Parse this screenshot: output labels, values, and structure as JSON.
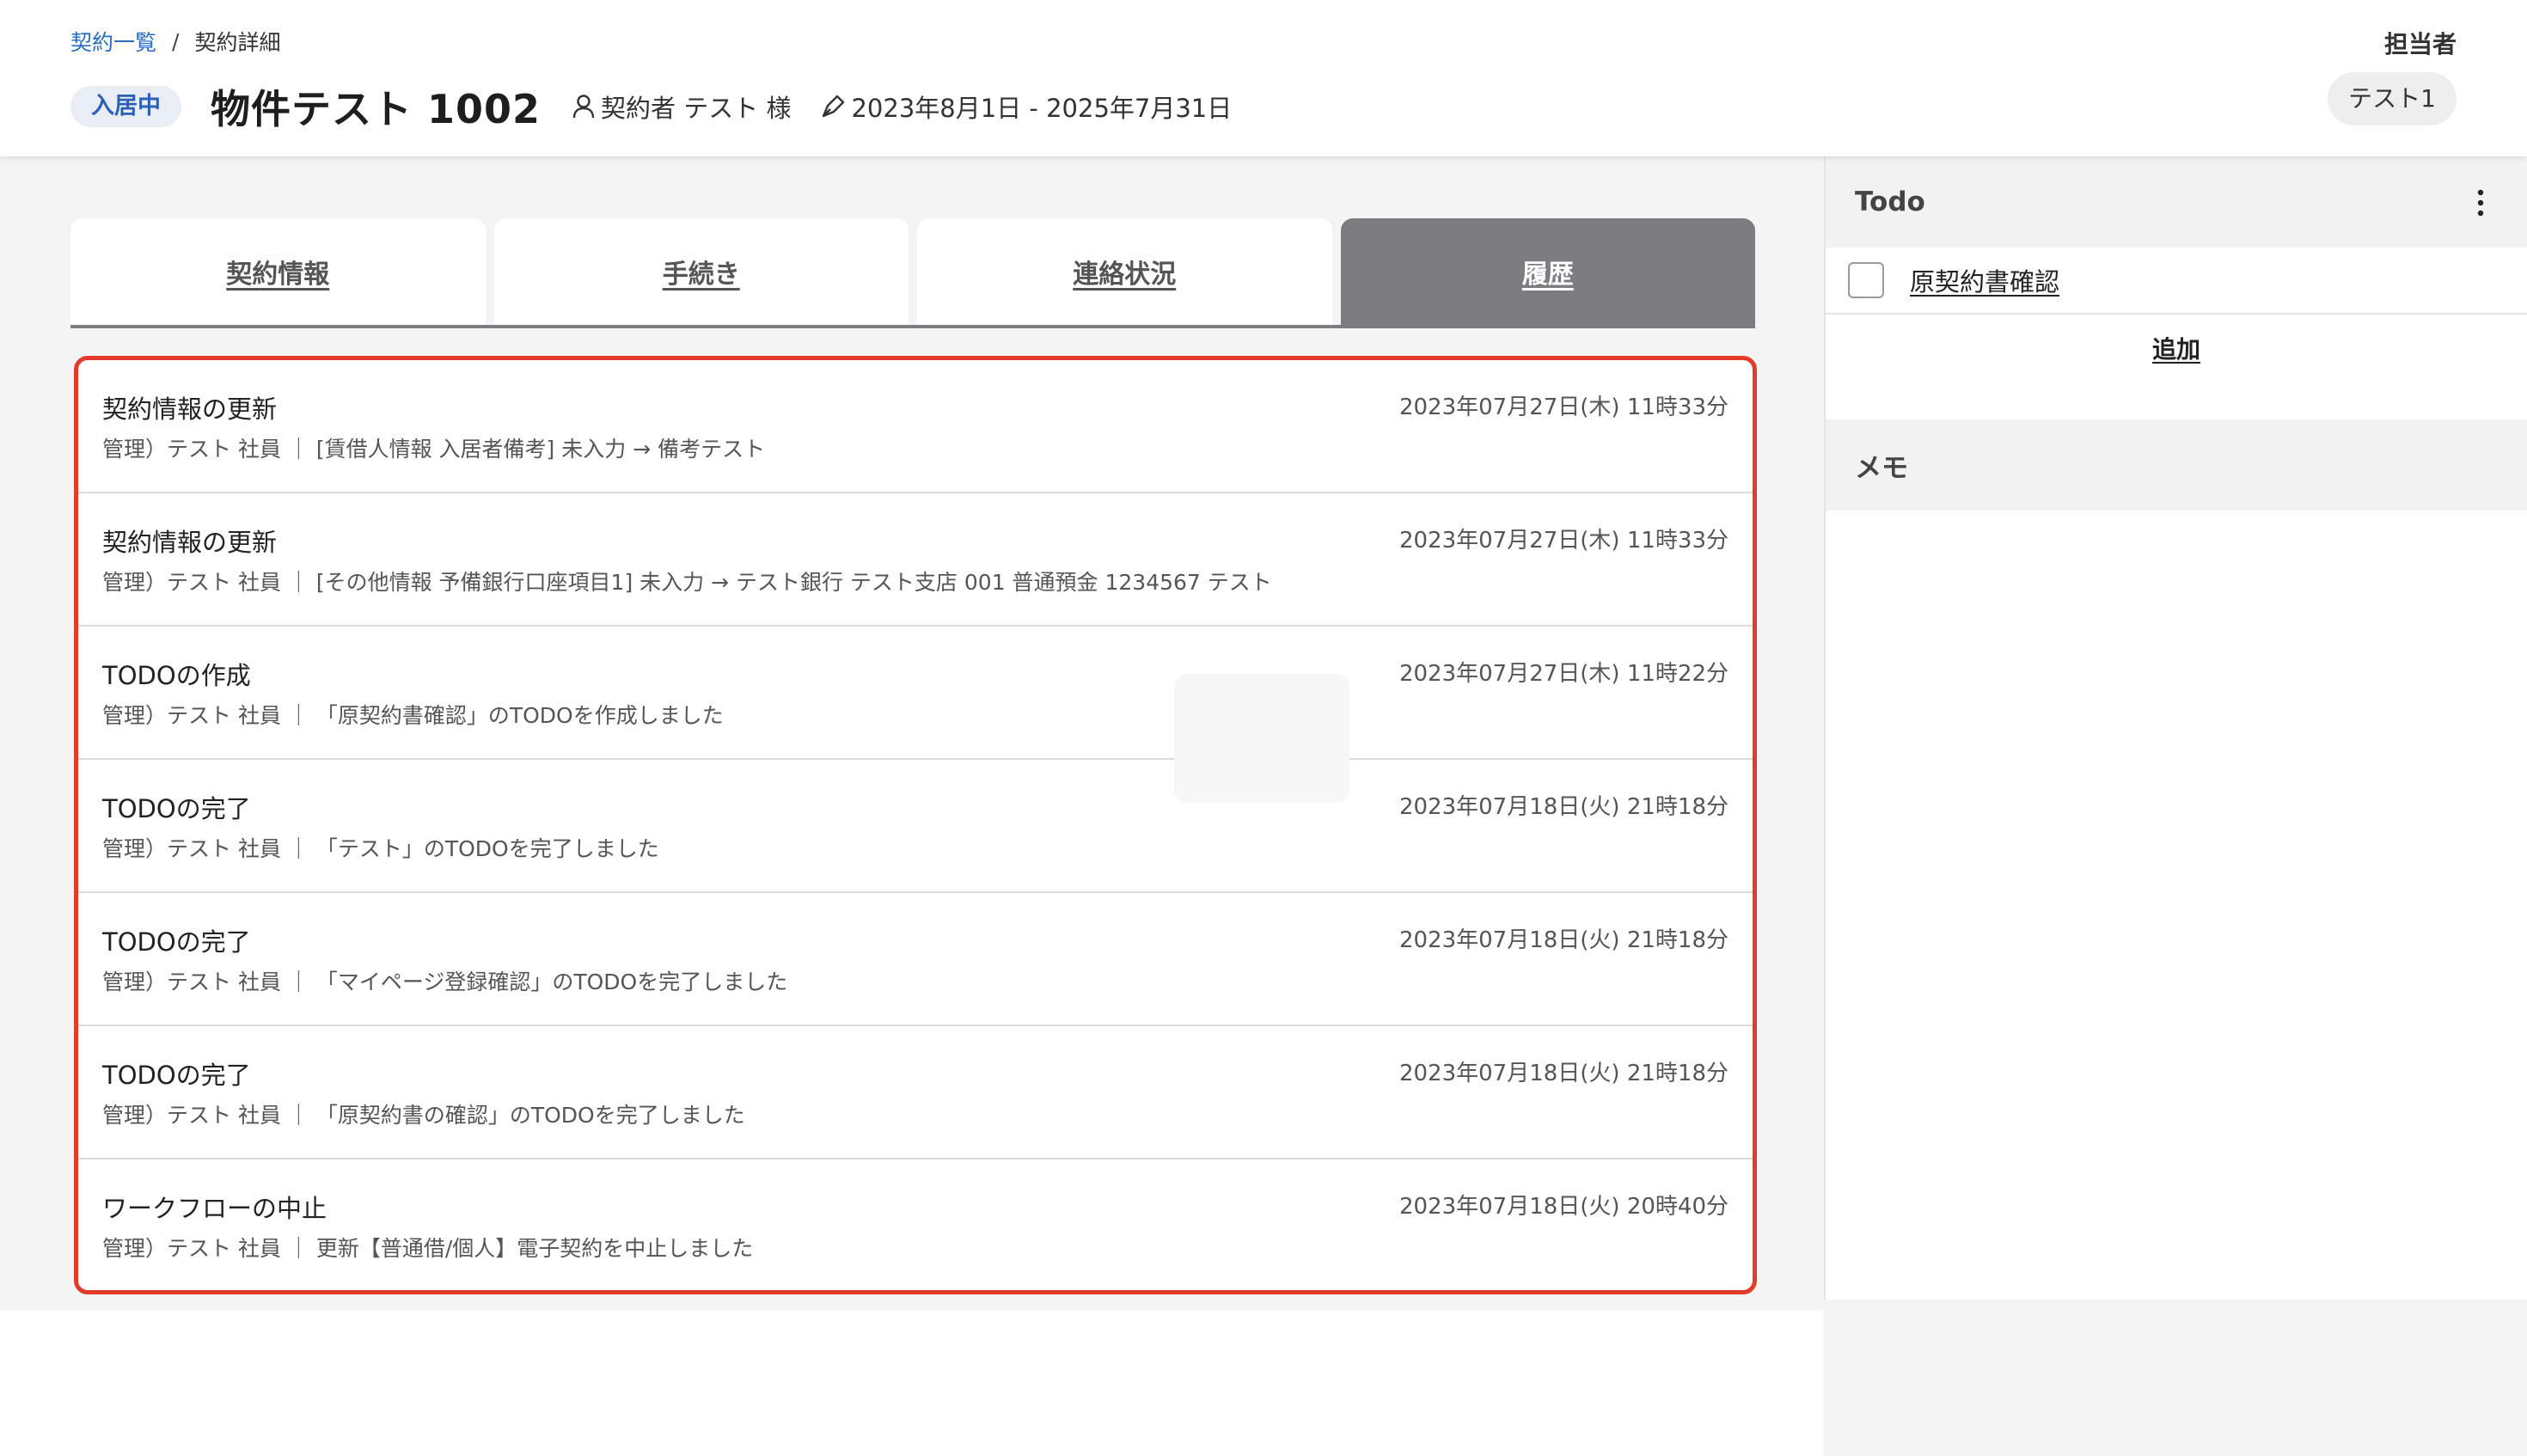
{
  "breadcrumb": {
    "parent": "契約一覧",
    "separator": "/",
    "current": "契約詳細"
  },
  "header": {
    "status_badge": "入居中",
    "title": "物件テスト 1002",
    "contractor": "契約者 テスト 様",
    "period": "2023年8月1日 - 2025年7月31日",
    "assignee_label": "担当者",
    "assignee": "テスト1"
  },
  "tabs": [
    {
      "label": "契約情報",
      "active": false
    },
    {
      "label": "手続き",
      "active": false
    },
    {
      "label": "連絡状況",
      "active": false
    },
    {
      "label": "履歴",
      "active": true
    }
  ],
  "history": [
    {
      "title": "契約情報の更新",
      "detail": "管理）テスト 社員 ｜ [賃借人情報 入居者備考] 未入力 → 備考テスト",
      "time": "2023年07月27日(木) 11時33分"
    },
    {
      "title": "契約情報の更新",
      "detail": "管理）テスト 社員 ｜ [その他情報 予備銀行口座項目1] 未入力 → テスト銀行 テスト支店 001 普通預金 1234567 テスト",
      "time": "2023年07月27日(木) 11時33分"
    },
    {
      "title": "TODOの作成",
      "detail": "管理）テスト 社員 ｜ 「原契約書確認」のTODOを作成しました",
      "time": "2023年07月27日(木) 11時22分"
    },
    {
      "title": "TODOの完了",
      "detail": "管理）テスト 社員 ｜ 「テスト」のTODOを完了しました",
      "time": "2023年07月18日(火) 21時18分"
    },
    {
      "title": "TODOの完了",
      "detail": "管理）テスト 社員 ｜ 「マイページ登録確認」のTODOを完了しました",
      "time": "2023年07月18日(火) 21時18分"
    },
    {
      "title": "TODOの完了",
      "detail": "管理）テスト 社員 ｜ 「原契約書の確認」のTODOを完了しました",
      "time": "2023年07月18日(火) 21時18分"
    },
    {
      "title": "ワークフローの中止",
      "detail": "管理）テスト 社員 ｜ 更新【普通借/個人】電子契約を中止しました",
      "time": "2023年07月18日(火) 20時40分"
    }
  ],
  "todo": {
    "title": "Todo",
    "items": [
      {
        "label": "原契約書確認",
        "checked": false
      }
    ],
    "add_label": "追加"
  },
  "memo": {
    "title": "メモ"
  },
  "colors": {
    "accent_blue": "#2b6cc4",
    "highlight_border": "#e23b2a",
    "active_tab": "#7c7c81"
  }
}
